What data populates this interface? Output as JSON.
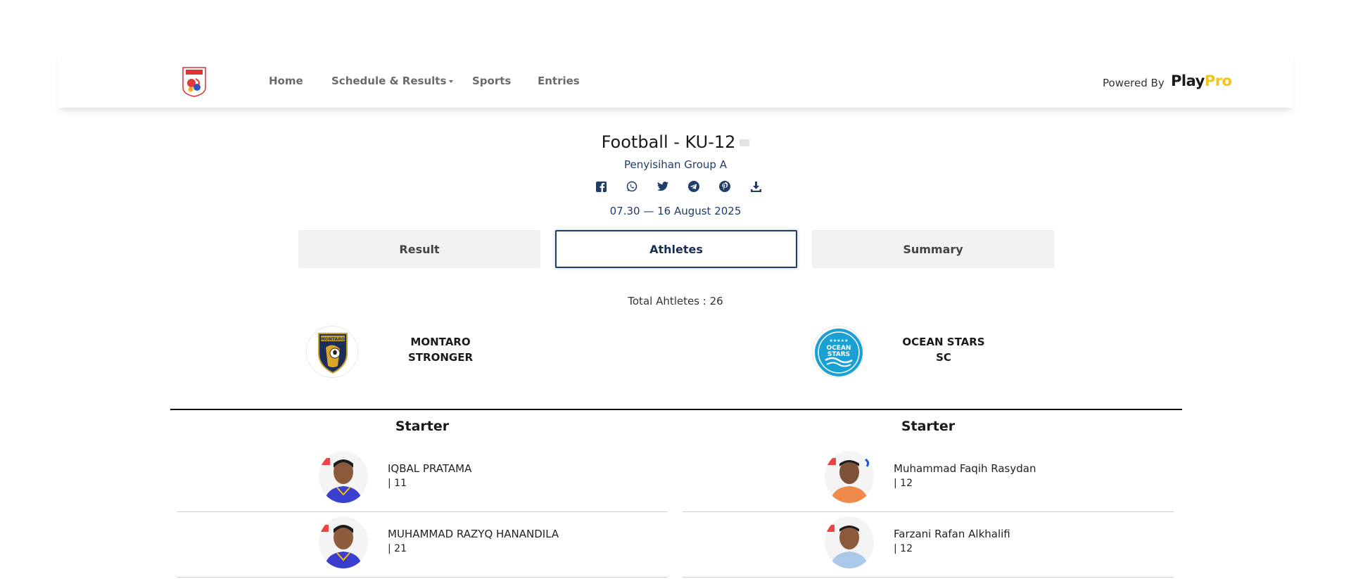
{
  "nav": {
    "home": "Home",
    "schedule": "Schedule & Results",
    "sports": "Sports",
    "entries": "Entries",
    "powered_by": "Powered By",
    "brand_play": "Play",
    "brand_pro": "Pro"
  },
  "event": {
    "title": "Football - KU-12",
    "subtitle": "Penyisihan Group A",
    "date": "07.30 — 16 August 2025",
    "share_icons": [
      "facebook-icon",
      "whatsapp-icon",
      "twitter-icon",
      "telegram-icon",
      "pinterest-icon",
      "download-icon"
    ]
  },
  "tabs": {
    "result": "Result",
    "athletes": "Athletes",
    "summary": "Summary"
  },
  "total_label": "Total Ahtletes : 26",
  "teams": {
    "home": {
      "name_line1": "MONTARO",
      "name_line2": "STRONGER",
      "section": "Starter"
    },
    "away": {
      "name_line1": "OCEAN STARS",
      "name_line2": "SC",
      "section": "Starter"
    }
  },
  "athletes": {
    "home": [
      {
        "name": "IQBAL PRATAMA",
        "number": "| 11"
      },
      {
        "name": "MUHAMMAD RAZYQ HANANDILA",
        "number": "| 21"
      }
    ],
    "away": [
      {
        "name": "Muhammad Faqih Rasydan",
        "number": "| 12"
      },
      {
        "name": "Farzani Rafan Alkhalifi",
        "number": "| 12"
      }
    ]
  },
  "colors": {
    "accent": "#1f3c6b",
    "brand_yellow": "#f5c518",
    "tab_bg": "#f2f2f2"
  }
}
